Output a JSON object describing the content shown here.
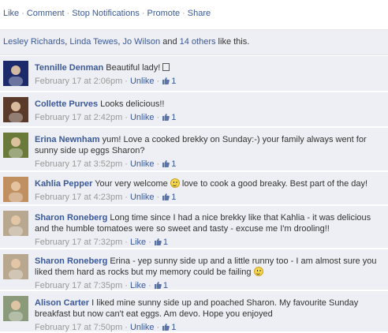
{
  "actions": {
    "like": "Like",
    "comment": "Comment",
    "stop_notifications": "Stop Notifications",
    "promote": "Promote",
    "share": "Share",
    "separator": "·"
  },
  "likes": {
    "name1": "Lesley Richards",
    "name2": "Linda Tewes",
    "name3": "Jo Wilson",
    "and": " and ",
    "others": "14 others",
    "suffix": " like this."
  },
  "comments": [
    {
      "author": "Tennille Denman",
      "text_before": "Beautiful lady!",
      "text_after": "",
      "timestamp": "February 17 at 2:06pm",
      "action": "Unlike",
      "like_count": "1",
      "avatar_color": "#1c2a6b"
    },
    {
      "author": "Collette Purves",
      "text_before": "Looks delicious!!",
      "text_after": "",
      "timestamp": "February 17 at 2:42pm",
      "action": "Unlike",
      "like_count": "1",
      "avatar_color": "#5a3a2a"
    },
    {
      "author": "Erina Newnham",
      "text_before": "yum! Love a cooked brekky on Sunday:-) your family always went for sunny side up eggs Sharon?",
      "text_after": "",
      "timestamp": "February 17 at 3:52pm",
      "action": "Unlike",
      "like_count": "1",
      "avatar_color": "#6a7a3a"
    },
    {
      "author": "Kahlia Pepper",
      "text_before": "Your very welcome",
      "text_after": "love to cook a good breaky. Best part of the day!",
      "timestamp": "February 17 at 4:23pm",
      "action": "Unlike",
      "like_count": "1",
      "avatar_color": "#c09060"
    },
    {
      "author": "Sharon Roneberg",
      "text_before": "Long time since I had a nice brekky like that Kahlia - it was delicious and the humble tomatoes were so sweet and tasty - excuse me I'm drooling!!",
      "text_after": "",
      "timestamp": "February 17 at 7:32pm",
      "action": "Like",
      "like_count": "1",
      "avatar_color": "#b8a890"
    },
    {
      "author": "Sharon Roneberg",
      "text_before": "Erina - yep sunny side up and a little runny too - I am almost sure you liked them hard as rocks but my memory could be failing",
      "text_after": "",
      "timestamp": "February 17 at 7:35pm",
      "action": "Like",
      "like_count": "1",
      "avatar_color": "#b8a890"
    },
    {
      "author": "Alison Carter",
      "text_before": "I liked mine sunny side up and poached Sharon. My favourite Sunday breakfast but now can't eat eggs. Am devo. Hope you enjoyed",
      "text_after": "",
      "timestamp": "February 17 at 7:50pm",
      "action": "Unlike",
      "like_count": "1",
      "avatar_color": "#8a9a7a"
    }
  ]
}
